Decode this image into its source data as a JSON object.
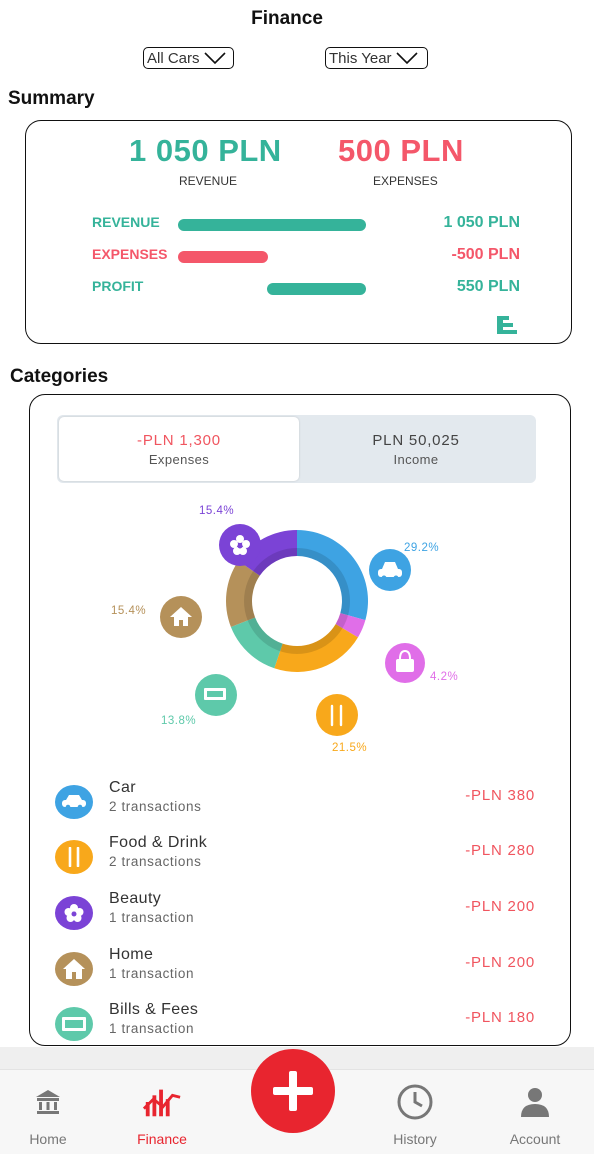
{
  "header": {
    "title": "Finance"
  },
  "filters": {
    "car_filter": "All Cars",
    "period_filter": "This Year"
  },
  "summary": {
    "section_title": "Summary",
    "revenue_amount": "1 050 PLN",
    "revenue_caption": "REVENUE",
    "expenses_amount": "500 PLN",
    "expenses_caption": "EXPENSES",
    "rows": [
      {
        "label": "REVENUE",
        "value": "1 050 PLN",
        "color": "#35b39a"
      },
      {
        "label": "EXPENSES",
        "value": "-500 PLN",
        "color": "#f4576a"
      },
      {
        "label": "PROFIT",
        "value": "550 PLN",
        "color": "#35b39a"
      }
    ],
    "icon": "bar-chart-icon"
  },
  "categories": {
    "section_title": "Categories",
    "tabs": [
      {
        "amount": "-PLN 1,300",
        "label": "Expenses",
        "active": true,
        "color": "#f0555f"
      },
      {
        "amount": "PLN 50,025",
        "label": "Income",
        "active": false,
        "color": "#444444"
      }
    ],
    "donut": [
      {
        "name": "Car",
        "percent": 29.2,
        "label": "29.2%",
        "color": "#3ea3e3",
        "icon": "car-icon"
      },
      {
        "name": "Shopping",
        "percent": 4.2,
        "label": "4.2%",
        "color": "#e06ee8",
        "icon": "shopping-bag-icon"
      },
      {
        "name": "Food & Drink",
        "percent": 21.5,
        "label": "21.5%",
        "color": "#f8a81b",
        "icon": "fork-knife-icon"
      },
      {
        "name": "Bills & Fees",
        "percent": 13.8,
        "label": "13.8%",
        "color": "#5ec9aa",
        "icon": "bills-icon"
      },
      {
        "name": "Home",
        "percent": 15.4,
        "label": "15.4%",
        "color": "#b5915a",
        "icon": "home-icon"
      },
      {
        "name": "Beauty",
        "percent": 15.4,
        "label": "15.4%",
        "color": "#7b43d6",
        "icon": "flower-icon"
      }
    ],
    "list": [
      {
        "name": "Car",
        "count": "2 transactions",
        "amount": "-PLN 380",
        "color": "#3ea3e3",
        "icon": "car-icon"
      },
      {
        "name": "Food & Drink",
        "count": "2 transactions",
        "amount": "-PLN 280",
        "color": "#f8a81b",
        "icon": "fork-knife-icon"
      },
      {
        "name": "Beauty",
        "count": "1 transaction",
        "amount": "-PLN 200",
        "color": "#7b43d6",
        "icon": "flower-icon"
      },
      {
        "name": "Home",
        "count": "1 transaction",
        "amount": "-PLN 200",
        "color": "#b5915a",
        "icon": "home-icon"
      },
      {
        "name": "Bills & Fees",
        "count": "1 transaction",
        "amount": "-PLN 180",
        "color": "#5ec9aa",
        "icon": "bills-icon"
      }
    ]
  },
  "nav": {
    "items": [
      {
        "label": "Home",
        "icon": "bank-icon",
        "active": false
      },
      {
        "label": "Finance",
        "icon": "finance-chart-icon",
        "active": true
      },
      {
        "label": "History",
        "icon": "clock-icon",
        "active": false
      },
      {
        "label": "Account",
        "icon": "person-icon",
        "active": false
      }
    ],
    "fab_icon": "plus-icon",
    "active_color": "#e8252f",
    "inactive_color": "#777777"
  }
}
